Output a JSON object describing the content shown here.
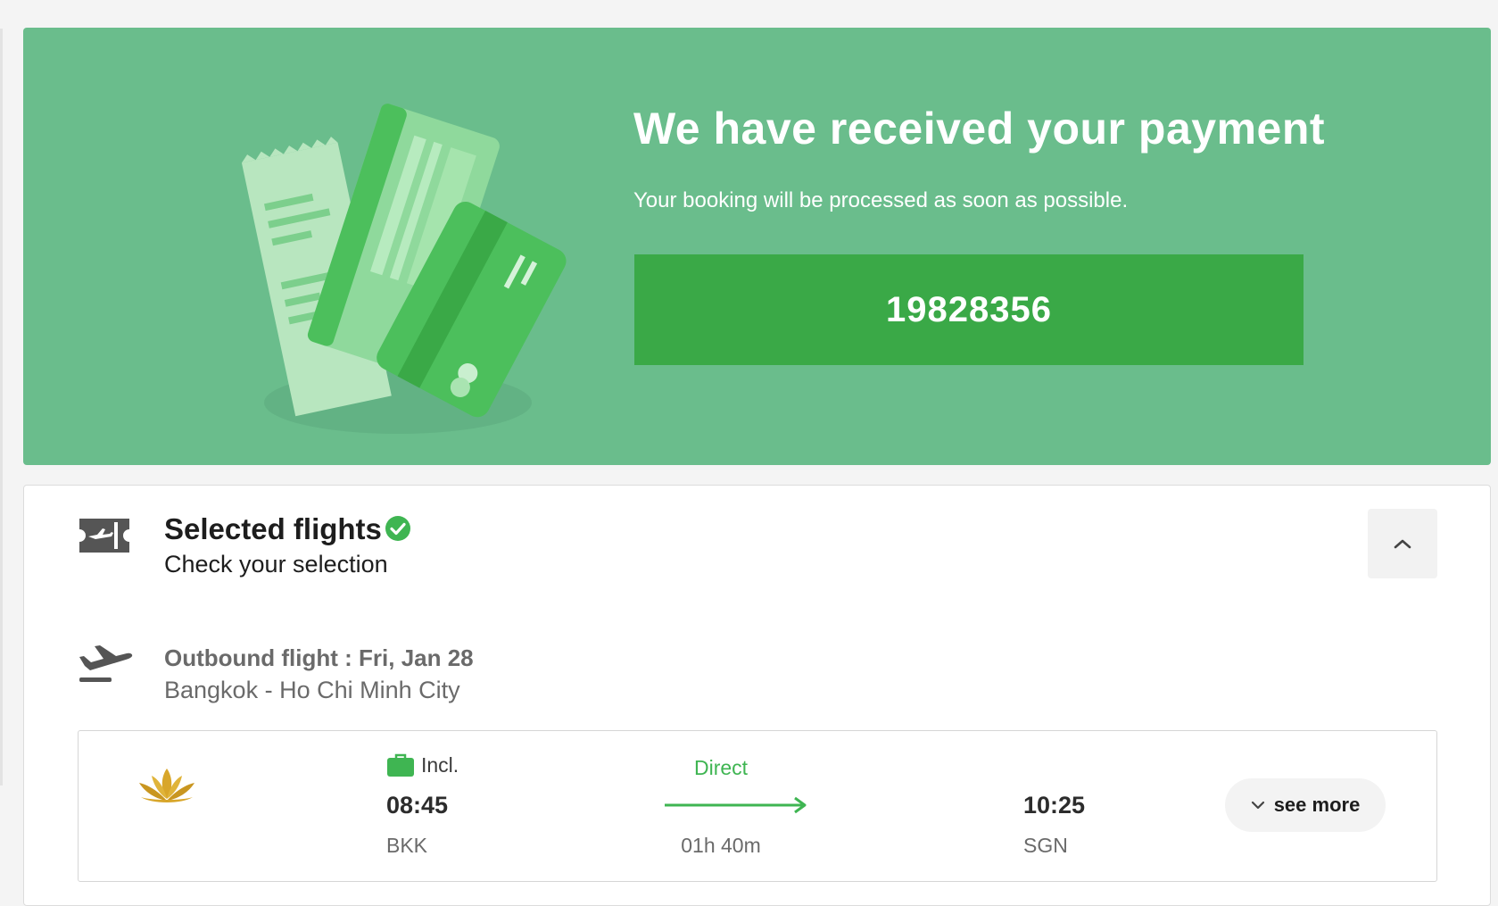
{
  "banner": {
    "title": "We have received your payment",
    "subtitle": "Your booking will be processed as soon as possible.",
    "booking_number": "19828356",
    "background_color": "#6abd8c",
    "booking_box_color": "#3aa947"
  },
  "selected_flights": {
    "title": "Selected flights",
    "subtitle": "Check your selection",
    "status_icon": "check-circle-icon",
    "collapse_icon": "chevron-up-icon"
  },
  "outbound": {
    "title": "Outbound flight : Fri, Jan 28",
    "route": "Bangkok - Ho Chi Minh City",
    "flight": {
      "airline_logo": "lotus-logo",
      "baggage_label": "Incl.",
      "departure_time": "08:45",
      "departure_code": "BKK",
      "stops": "Direct",
      "duration": "01h 40m",
      "arrival_time": "10:25",
      "arrival_code": "SGN",
      "see_more_label": "see more"
    }
  },
  "colors": {
    "accent_green": "#3fb552",
    "text_dark": "#1d1d1d",
    "text_muted": "#6a6a6a"
  }
}
